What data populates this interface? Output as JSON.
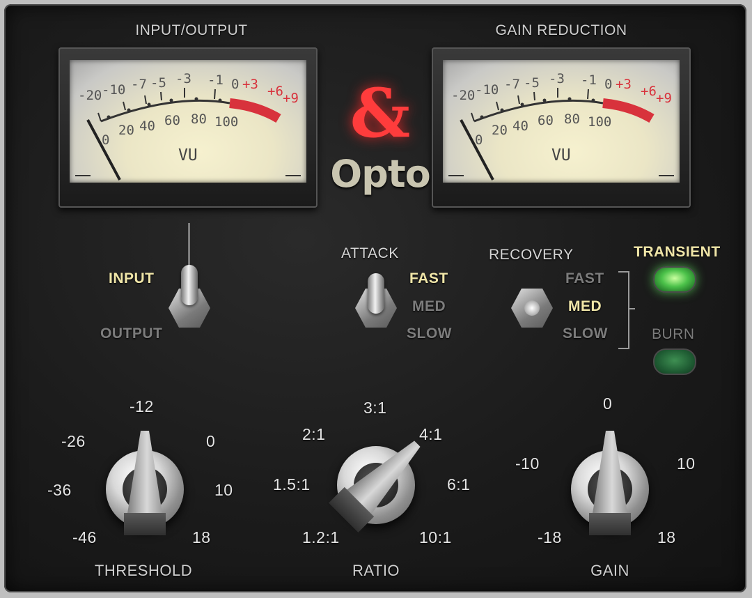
{
  "meters": {
    "left_title": "INPUT/OUTPUT",
    "right_title": "GAIN REDUCTION",
    "top_scale": [
      "-20",
      "-10",
      "-7",
      "-5",
      "-3",
      "-1",
      "0",
      "+3",
      "+6",
      "+9"
    ],
    "bottom_scale": [
      "0",
      "20",
      "40",
      "60",
      "80",
      "100"
    ],
    "unit": "VU"
  },
  "logo": {
    "symbol": "&",
    "name": "Opto"
  },
  "meter_switch": {
    "up_label": "INPUT",
    "down_label": "OUTPUT",
    "selected": "INPUT"
  },
  "attack": {
    "title": "ATTACK",
    "options": [
      "FAST",
      "MED",
      "SLOW"
    ],
    "selected": "FAST"
  },
  "recovery": {
    "title": "RECOVERY",
    "options": [
      "FAST",
      "MED",
      "SLOW"
    ],
    "selected": "MED"
  },
  "transient": {
    "label": "TRANSIENT",
    "state": "on"
  },
  "burn": {
    "label": "BURN",
    "state": "off"
  },
  "threshold": {
    "title": "THRESHOLD",
    "scale": [
      "-46",
      "-36",
      "-26",
      "-12",
      "0",
      "10",
      "18"
    ],
    "value": "-12"
  },
  "ratio": {
    "title": "RATIO",
    "scale": [
      "1.2:1",
      "1.5:1",
      "2:1",
      "3:1",
      "4:1",
      "6:1",
      "10:1"
    ],
    "value": "4:1"
  },
  "gain": {
    "title": "GAIN",
    "scale": [
      "-18",
      "-10",
      "0",
      "10",
      "18"
    ],
    "value": "0"
  },
  "colors": {
    "led_on": "#4cc24a",
    "led_off": "#1f5c33",
    "logo_red": "#ff3c3c",
    "lit_label": "#f0e6a8",
    "meter_red": "#d8323c"
  }
}
